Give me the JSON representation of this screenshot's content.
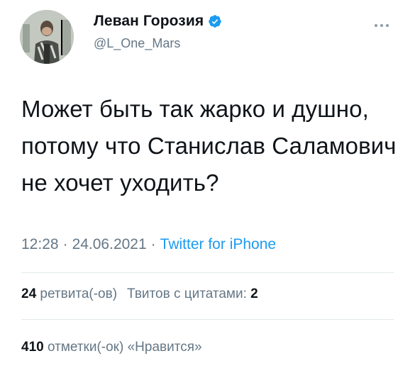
{
  "author": {
    "display_name": "Леван Горозия",
    "handle": "@L_One_Mars",
    "verified": true,
    "avatar_icon": "profile-photo"
  },
  "menu_icon": "more-dots-icon",
  "tweet": {
    "text": "Может быть так жарко и душно, потому что Станислав Саламович не хочет уходить?",
    "time": "12:28",
    "separator": "·",
    "date": "24.06.2021",
    "source": "Twitter for iPhone"
  },
  "stats": {
    "retweets_count": "24",
    "retweets_label": "ретвита(-ов)",
    "quotes_label": "Твитов с цитатами:",
    "quotes_count": "2",
    "likes_count": "410",
    "likes_label": "отметки(-ок) «Нравится»"
  },
  "colors": {
    "text": "#0f1419",
    "secondary": "#657786",
    "accent": "#1d9bf0",
    "divider": "#e1e8ed"
  }
}
